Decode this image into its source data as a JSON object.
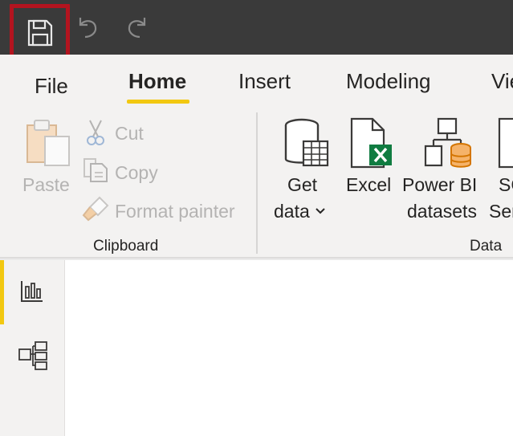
{
  "quick_access": {
    "save_icon": "save-icon",
    "undo_icon": "undo-icon",
    "redo_icon": "redo-icon",
    "highlight_color": "#b3141f"
  },
  "tabs": [
    {
      "label": "File"
    },
    {
      "label": "Home"
    },
    {
      "label": "Insert"
    },
    {
      "label": "Modeling"
    },
    {
      "label": "Vie"
    }
  ],
  "accent_color": "#f2c811",
  "clipboard": {
    "paste": "Paste",
    "cut": "Cut",
    "copy": "Copy",
    "format_painter": "Format painter",
    "group_label": "Clipboard"
  },
  "data": {
    "get_data_line1": "Get",
    "get_data_line2": "data",
    "excel": "Excel",
    "powerbi_line1": "Power BI",
    "powerbi_line2": "datasets",
    "sql_line1": "SC",
    "sql_line2": "Ser",
    "group_label": "Data"
  },
  "left_rail": {
    "report_icon": "report-view-icon",
    "model_icon": "model-view-icon"
  }
}
